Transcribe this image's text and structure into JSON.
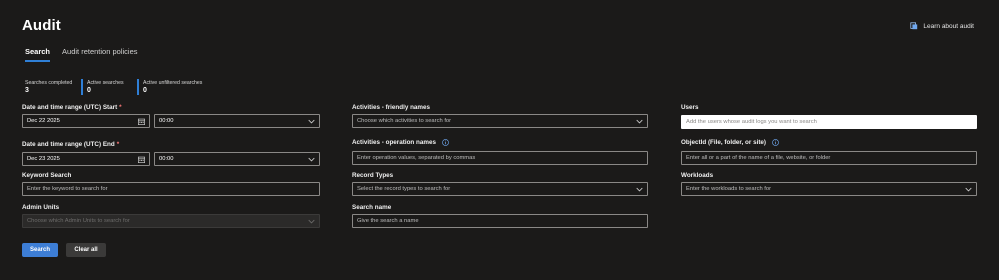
{
  "header": {
    "title": "Audit",
    "learn_link": "Learn about audit"
  },
  "tabs": [
    {
      "label": "Search",
      "active": true
    },
    {
      "label": "Audit retention policies",
      "active": false
    }
  ],
  "stats": [
    {
      "label": "Searches completed",
      "value": "3"
    },
    {
      "label": "Active searches",
      "value": "0"
    },
    {
      "label": "Active unfiltered searches",
      "value": "0"
    }
  ],
  "form": {
    "start": {
      "label": "Date and time range (UTC) Start",
      "required": "*",
      "date": "Dec 22 2025",
      "time": "00:00"
    },
    "end": {
      "label": "Date and time range (UTC) End",
      "required": "*",
      "date": "Dec 23 2025",
      "time": "00:00"
    },
    "keyword": {
      "label": "Keyword Search",
      "placeholder": "Enter the keyword to search for"
    },
    "admin_units": {
      "label": "Admin Units",
      "placeholder": "Choose which Admin Units to search for"
    },
    "activities_friendly": {
      "label": "Activities - friendly names",
      "placeholder": "Choose which activities to search for"
    },
    "activities_ops": {
      "label": "Activities - operation names",
      "placeholder": "Enter operation values, separated by commas"
    },
    "record_types": {
      "label": "Record Types",
      "placeholder": "Select the record types to search for"
    },
    "search_name": {
      "label": "Search name",
      "placeholder": "Give the search a name"
    },
    "users": {
      "label": "Users",
      "placeholder": "Add the users whose audit logs you want to search"
    },
    "objectid": {
      "label": "ObjectId (File, folder, or site)",
      "placeholder": "Enter all or a part of the name of a file, website, or folder"
    },
    "workloads": {
      "label": "Workloads",
      "placeholder": "Enter the workloads to search for"
    }
  },
  "buttons": {
    "search": "Search",
    "clear": "Clear all"
  },
  "colors": {
    "background": "#1b1a19",
    "accent": "#3d7ed6",
    "required": "#ff7a7a"
  }
}
